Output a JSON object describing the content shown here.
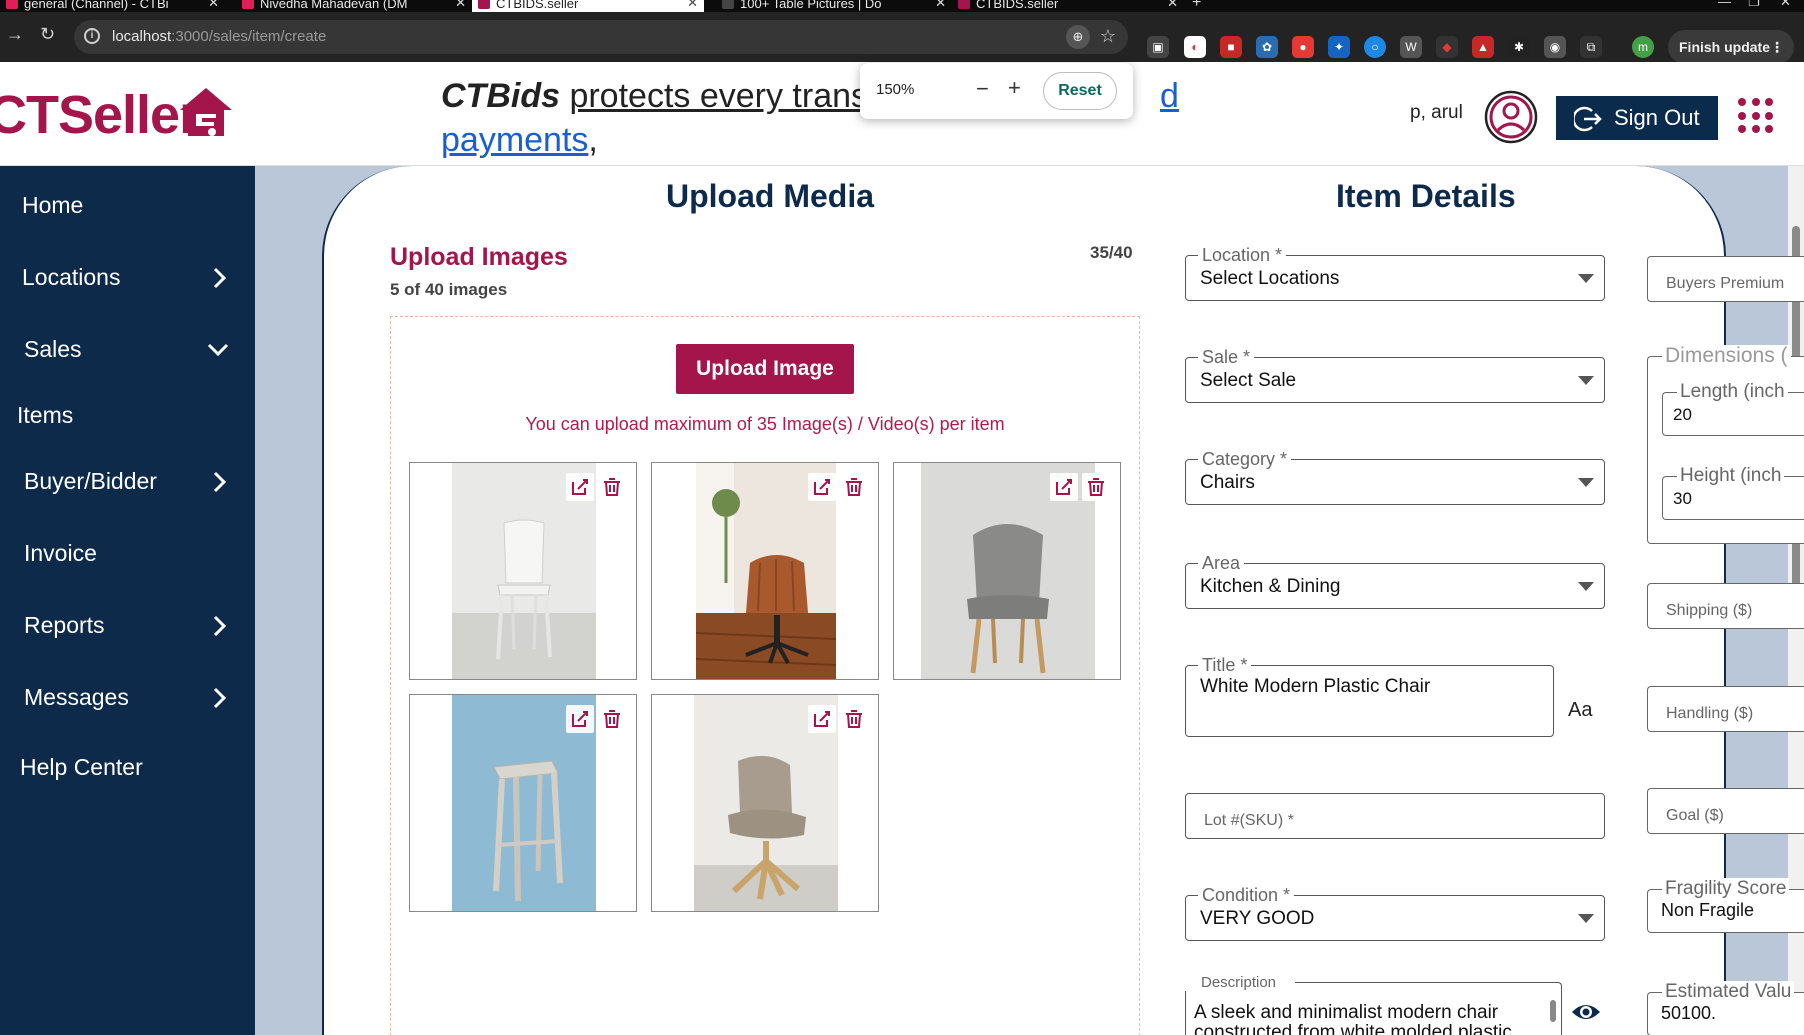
{
  "browser": {
    "tabs": [
      {
        "title": "general (Channel) - CTBi",
        "color": "#e01e5a"
      },
      {
        "title": "Nivedha Mahadevan (DM",
        "color": "#e01e5a"
      },
      {
        "title": "CTBIDS.seller",
        "color": "#a3154b"
      },
      {
        "title": "100+ Table Pictures | Do",
        "color": "#444444"
      },
      {
        "title": "CTBIDS.seller",
        "color": "#a3154b"
      }
    ],
    "url_host": "localhost",
    "url_path": ":3000/sales/item/create",
    "finish_update": "Finish update",
    "profile_initial": "m"
  },
  "zoom": {
    "level": "150%",
    "minus": "−",
    "plus": "+",
    "reset": "Reset"
  },
  "header": {
    "logo_text": "CTSeller",
    "banner_brand": "CTBids",
    "banner_text": "protects every trans",
    "banner_link_tail": "d",
    "banner_link_line2": "payments",
    "banner_comma": ",",
    "user_name": "p, arul",
    "sign_out": "Sign Out"
  },
  "sidebar": {
    "items": [
      {
        "label": "Home",
        "chevron": ""
      },
      {
        "label": "Locations",
        "chevron": "right"
      },
      {
        "label": "Sales",
        "chevron": "down"
      },
      {
        "label": "Items",
        "chevron": ""
      },
      {
        "label": "Buyer/Bidder",
        "chevron": "right"
      },
      {
        "label": "Invoice",
        "chevron": ""
      },
      {
        "label": "Reports",
        "chevron": "right"
      },
      {
        "label": "Messages",
        "chevron": "right"
      },
      {
        "label": "Help Center",
        "chevron": ""
      }
    ]
  },
  "upload": {
    "heading": "Upload Media",
    "title": "Upload Images",
    "subtitle": "5 of 40 images",
    "counter": "35/40",
    "button": "Upload Image",
    "limit_note": "You can upload maximum of 35 Image(s) / Video(s) per item",
    "images": [
      {
        "alt": "white-plastic-chair"
      },
      {
        "alt": "brown-leather-office-chair"
      },
      {
        "alt": "grey-upholstered-dining-chair"
      },
      {
        "alt": "wooden-stool"
      },
      {
        "alt": "beige-swivel-lounge-chair"
      }
    ]
  },
  "details": {
    "heading": "Item Details",
    "location": {
      "label": "Location *",
      "value": "Select Locations"
    },
    "sale": {
      "label": "Sale *",
      "value": "Select Sale"
    },
    "category": {
      "label": "Category *",
      "value": "Chairs"
    },
    "area": {
      "label": "Area",
      "value": "Kitchen & Dining"
    },
    "title": {
      "label": "Title *",
      "value": "White Modern Plastic Chair",
      "case_toggle": "Aa"
    },
    "lot": {
      "placeholder": "Lot #(SKU) *"
    },
    "condition": {
      "label": "Condition *",
      "value": "VERY GOOD"
    },
    "description": {
      "label": "Description",
      "value": "A sleek and minimalist modern chair constructed from white molded plastic"
    }
  },
  "right_col": {
    "buyers_premium": "Buyers Premium",
    "dimensions": "Dimensions (",
    "length": {
      "label": "Length (inch",
      "value": "20"
    },
    "height": {
      "label": "Height (inch",
      "value": "30"
    },
    "shipping": "Shipping ($)",
    "handling": "Handling ($)",
    "goal": "Goal ($)",
    "fragility": {
      "label": "Fragility Score",
      "value": "Non Fragile"
    },
    "estimated": {
      "label": "Estimated Valu",
      "value": "50100."
    }
  },
  "colors": {
    "brand": "#a3154b",
    "navy": "#0d2a4a",
    "link": "#1a5fd0"
  }
}
